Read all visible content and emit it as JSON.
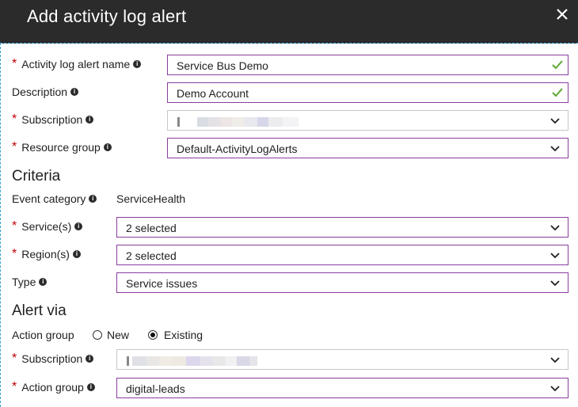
{
  "header": {
    "title": "Add activity log alert"
  },
  "form": {
    "alert_name": {
      "label": "Activity log alert name",
      "value": "Service Bus Demo"
    },
    "description": {
      "label": "Description",
      "value": "Demo Account"
    },
    "subscription": {
      "label": "Subscription"
    },
    "resource_group": {
      "label": "Resource group",
      "value": "Default-ActivityLogAlerts"
    }
  },
  "criteria": {
    "heading": "Criteria",
    "event_category": {
      "label": "Event category",
      "value": "ServiceHealth"
    },
    "services": {
      "label": "Service(s)",
      "value": "2 selected"
    },
    "regions": {
      "label": "Region(s)",
      "value": "2 selected"
    },
    "type": {
      "label": "Type",
      "value": "Service issues"
    }
  },
  "alert_via": {
    "heading": "Alert via",
    "action_group_choice": {
      "label": "Action group",
      "option_new": "New",
      "option_existing": "Existing",
      "selected": "Existing"
    },
    "subscription": {
      "label": "Subscription"
    },
    "action_group": {
      "label": "Action group",
      "value": "digital-leads"
    }
  },
  "colors": {
    "accent_border": "#8a3d9e",
    "check_green": "#5ea832",
    "header_bg": "#2b2b2b",
    "required": "#c00000"
  }
}
